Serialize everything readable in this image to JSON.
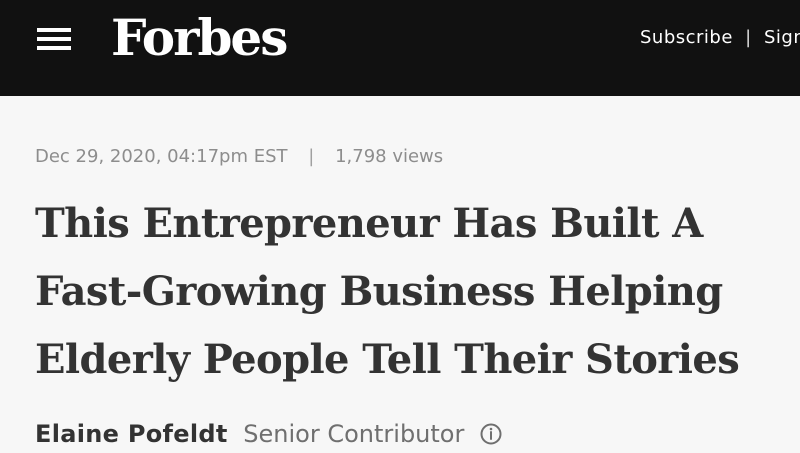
{
  "header": {
    "menu_icon": "hamburger-menu-icon",
    "logo": "Forbes",
    "subscribe_label": "Subscribe",
    "divider": "|",
    "sign_in_label": "Sign"
  },
  "article": {
    "date": "Dec 29, 2020, 04:17pm EST",
    "separator": "|",
    "views": "1,798 views",
    "headline_lines": [
      "This Entrepreneur Has Built A",
      "Fast-Growing Business Helping",
      "Elderly People Tell Their Stories"
    ],
    "author": {
      "name": "Elaine Pofeldt",
      "role": "Senior Contributor",
      "info_icon": "info-icon"
    }
  },
  "colors": {
    "header_background": "#111111",
    "page_background": "#f7f7f7",
    "headline_text": "#333333",
    "meta_text": "#8d8d8d"
  }
}
